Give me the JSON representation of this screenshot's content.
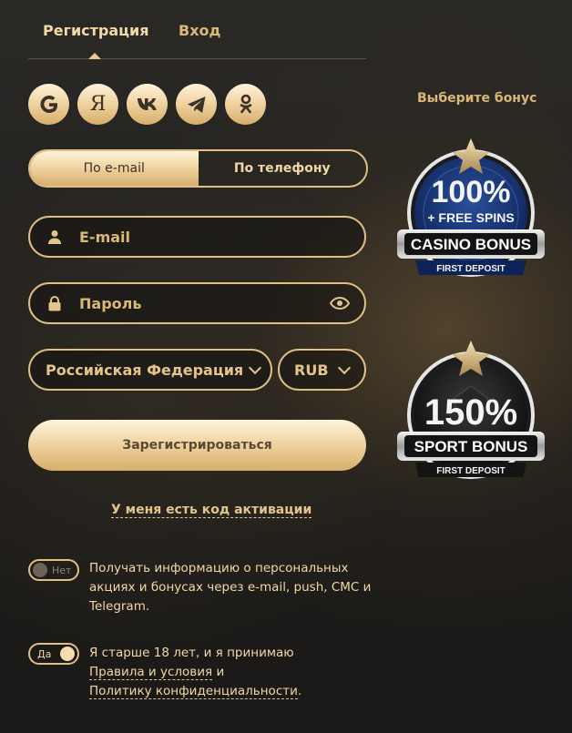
{
  "tabs": {
    "register": "Регистрация",
    "login": "Вход"
  },
  "social": [
    {
      "icon": "google-icon",
      "glyph": "G"
    },
    {
      "icon": "yandex-icon",
      "glyph": "Я"
    },
    {
      "icon": "vk-icon",
      "glyph": "vk"
    },
    {
      "icon": "telegram-icon",
      "glyph": "tg"
    },
    {
      "icon": "odnoklassniki-icon",
      "glyph": "ok"
    }
  ],
  "method": {
    "email": "По e-mail",
    "phone": "По телефону",
    "selected": "email"
  },
  "fields": {
    "email": {
      "placeholder": "E-mail",
      "value": ""
    },
    "password": {
      "placeholder": "Пароль",
      "value": ""
    }
  },
  "country": {
    "selected": "Российская Федерация"
  },
  "currency": {
    "selected": "RUB"
  },
  "register_button": "Зарегистрироваться",
  "activation_link": "У меня есть код активации",
  "options": {
    "promo": {
      "state": "Нет",
      "enabled": false,
      "text": "Получать информацию о персональных акциях и бонусах через e-mail, push, СМС и Telegram."
    },
    "age": {
      "state": "Да",
      "enabled": true,
      "text": "Я старше 18 лет, и я принимаю",
      "terms_link": "Правила и условия",
      "conj": "и",
      "privacy_link": "Политику конфиденциальности",
      "period": "."
    }
  },
  "bonus": {
    "title": "Выберите бонус",
    "casino": {
      "percent": "100%",
      "extra": "+ FREE SPINS",
      "label": "CASINO BONUS",
      "sub": "FIRST DEPOSIT"
    },
    "sport": {
      "percent": "150%",
      "label": "SPORT BONUS",
      "sub": "FIRST DEPOSIT"
    }
  },
  "colors": {
    "gold": "#e0bf85",
    "gold_light": "#f3d9a8",
    "casino_blue": "#1a3a7a",
    "bg": "#23211e"
  }
}
